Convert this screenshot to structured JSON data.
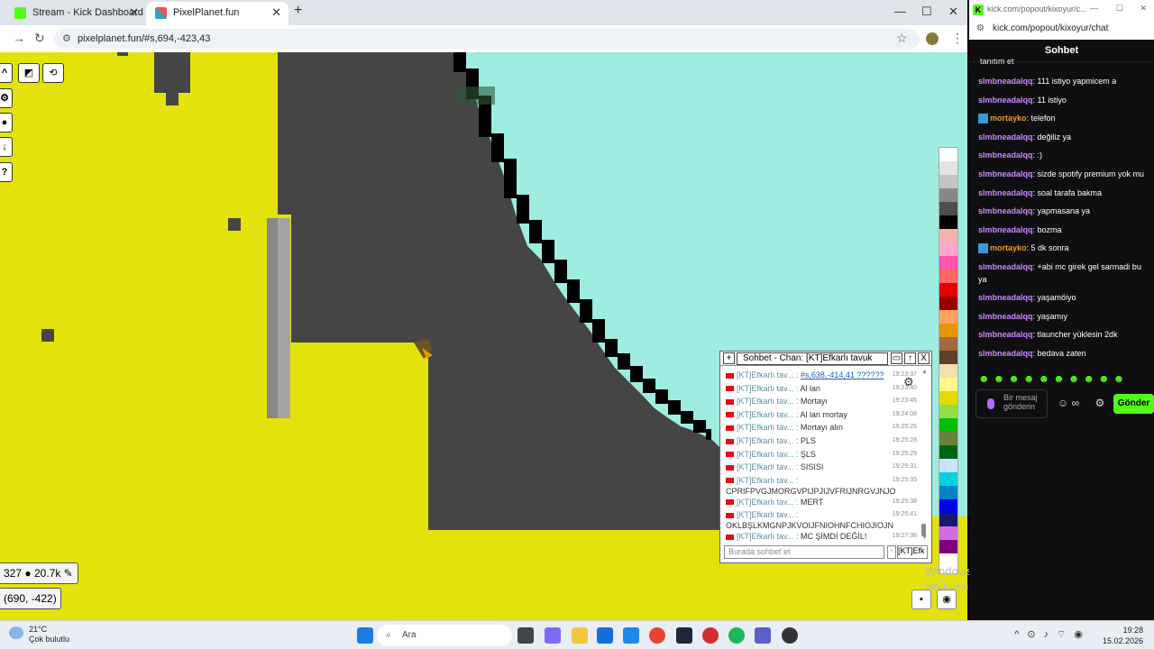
{
  "browser": {
    "tabs": [
      {
        "label": "Stream - Kick Dashboard",
        "icon": "kick-icon"
      },
      {
        "label": "PixelPlanet.fun",
        "icon": "pixelplanet-icon"
      }
    ],
    "url": "pixelplanet.fun/#s,694,-423,43"
  },
  "canvas": {
    "stats": {
      "online": "327",
      "pixels": "20.7k"
    },
    "coords": "(690, -422)"
  },
  "chat": {
    "title": "Sohbet - Chan: [KT]Efkarlı tavuk",
    "messages": [
      {
        "name": "[KT]Efkarlı tav... :",
        "text": "#s,638,-414,41 ??????",
        "time": "19:23:37"
      },
      {
        "name": "[KT]Efkarlı tav... :",
        "text": "Al lan",
        "time": "19:23:40"
      },
      {
        "name": "[KT]Efkarlı tav... :",
        "text": "Mortayı",
        "time": "19:23:45"
      },
      {
        "name": "[KT]Efkarlı tav... :",
        "text": "Al lan mortay",
        "time": "19:24:08"
      },
      {
        "name": "[KT]Efkarlı tav... :",
        "text": "Mortayı alın",
        "time": "19:25:26"
      },
      {
        "name": "[KT]Efkarlı tav... :",
        "text": "PLS",
        "time": "19:25:28"
      },
      {
        "name": "[KT]Efkarlı tav... :",
        "text": "ŞLS",
        "time": "19:25:29"
      },
      {
        "name": "[KT]Efkarlı tav... :",
        "text": "SISISI",
        "time": "19:25:31"
      },
      {
        "name": "[KT]Efkarlı tav... :",
        "text": "CPRIFPVGJMORGVPIJPJIJVFRIJNRGVJNJO",
        "time": "19:25:35"
      },
      {
        "name": "[KT]Efkarlı tav... :",
        "text": "MERT",
        "time": "19:25:38"
      },
      {
        "name": "[KT]Efkarlı tav... :",
        "text": "OKLBŞLKMGNPJKVOIJFNIOHNFCHIOJIOJN",
        "time": "19:25:41"
      },
      {
        "name": "[KT]Efkarlı tav... :",
        "text": "MC ŞİMDİ DEĞİL!",
        "time": "19:27:36"
      }
    ],
    "input_placeholder": "Burada sohbet et",
    "channel": "[KT]Efk"
  },
  "watermark": {
    "title": "Windows'u Etkinleştir",
    "subtitle": "Windows'u etkinleştirmek için Ayarlar'a gidin."
  },
  "kick": {
    "window_title": "kick.com/popout/kixoyur/c...",
    "url": "kick.com/popout/kixoyur/chat",
    "header": "Sohbet",
    "top_fragment": "tanıtım et",
    "messages": [
      {
        "user": "slmbneadalqq",
        "text": ": 111 istiyo yapmicem a",
        "type": "purple"
      },
      {
        "user": "slmbneadalqq",
        "text": ": 11 istiyo",
        "type": "purple"
      },
      {
        "user": "mortayko",
        "text": ": telefon",
        "type": "orange"
      },
      {
        "user": "slmbneadalqq",
        "text": ": değiliz ya",
        "type": "purple"
      },
      {
        "user": "slmbneadalqq",
        "text": ": :)",
        "type": "purple"
      },
      {
        "user": "slmbneadalqq",
        "text": ": sizde spotify premium yok mu",
        "type": "purple"
      },
      {
        "user": "slmbneadalqq",
        "text": ": soal tarafa bakma",
        "type": "purple"
      },
      {
        "user": "slmbneadalqq",
        "text": ": yapmasana ya",
        "type": "purple"
      },
      {
        "user": "slmbneadalqq",
        "text": ": bozma",
        "type": "purple"
      },
      {
        "user": "mortayko",
        "text": ": 5 dk sonra",
        "type": "orange"
      },
      {
        "user": "slmbneadalqq",
        "text": ": +abi mc girek gel sarmadi bu ya",
        "type": "purple"
      },
      {
        "user": "slmbneadalqq",
        "text": ": yaşamöiyo",
        "type": "purple"
      },
      {
        "user": "slmbneadalqq",
        "text": ": yaşamıy",
        "type": "purple"
      },
      {
        "user": "slmbneadalqq",
        "text": ": tlauncher yüklesin 2dk",
        "type": "purple"
      },
      {
        "user": "slmbneadalqq",
        "text": ": bedava zaten",
        "type": "purple"
      }
    ],
    "input_placeholder": "Bir mesaj gönderin",
    "send_label": "Gönder"
  },
  "taskbar": {
    "temperature": "21°C",
    "weather": "Çok bulutlu",
    "search": "Ara",
    "time": "19:28",
    "date": "15.02.2026"
  }
}
